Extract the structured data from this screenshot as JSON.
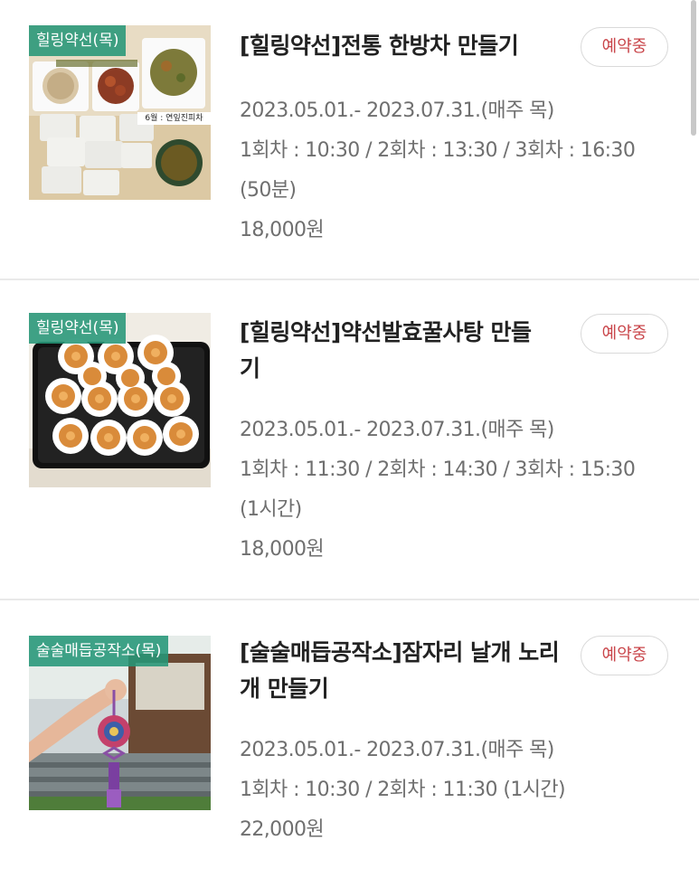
{
  "programs": [
    {
      "tag": "힐링약선(목)",
      "title": "[힐링약선]전통 한방차 만들기",
      "status": "예약중",
      "period": "2023.05.01.- 2023.07.31.(매주 목)",
      "schedule": "1회차 : 10:30 / 2회차 : 13:30 / 3회차 : 16:30 (50분)",
      "price": "18,000원",
      "image_caption": "6월 : 연잎진피차",
      "image_subject": "herbal-tea-image"
    },
    {
      "tag": "힐링약선(목)",
      "title": "[힐링약선]약선발효꿀사탕 만들기",
      "status": "예약중",
      "period": "2023.05.01.- 2023.07.31.(매주 목)",
      "schedule": "1회차 : 11:30 / 2회차 : 14:30 / 3회차 : 15:30 (1시간)",
      "price": "18,000원",
      "image_subject": "honey-candy-image"
    },
    {
      "tag": "술술매듭공작소(목)",
      "title": "[술술매듭공작소]잠자리 날개 노리개 만들기",
      "status": "예약중",
      "period": "2023.05.01.- 2023.07.31.(매주 목)",
      "schedule": "1회차 : 10:30 / 2회차 : 11:30 (1시간)",
      "price": "22,000원",
      "image_subject": "norigae-image"
    }
  ],
  "colors": {
    "tag_bg": "#269678",
    "badge_text": "#c9454a",
    "meta_text": "#6f6f6f",
    "title_text": "#222222",
    "divider": "#e9e9e9"
  }
}
